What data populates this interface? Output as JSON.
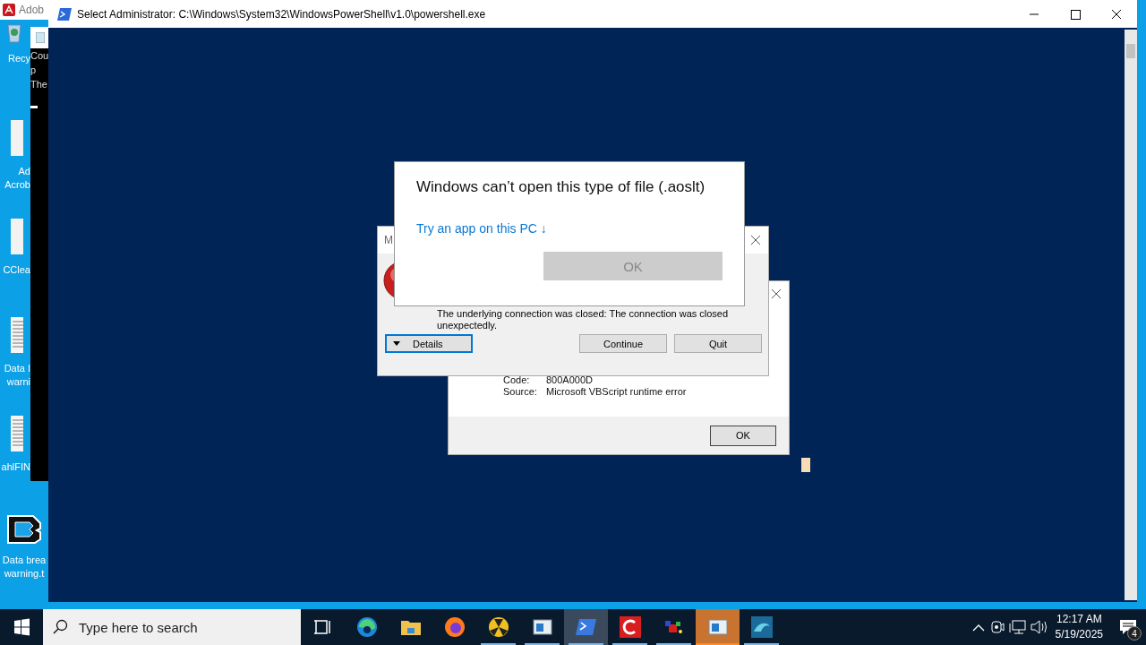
{
  "background_windows": {
    "adobe_title": "Adob",
    "console_lines": [
      "Cou",
      "p",
      "The"
    ]
  },
  "desktop_icons": [
    {
      "kind": "recycle",
      "lines": [
        "Recy"
      ]
    },
    {
      "kind": "document",
      "lines": [
        "Ad",
        "Acrob"
      ]
    },
    {
      "kind": "document",
      "lines": [
        "CClea"
      ]
    },
    {
      "kind": "textfile",
      "lines": [
        "Data I",
        "warni"
      ]
    },
    {
      "kind": "textfile",
      "lines": [
        "ahlFIN"
      ]
    },
    {
      "kind": "logo",
      "lines": [
        "Data brea",
        "warning.t"
      ]
    }
  ],
  "powershell": {
    "title": "Select Administrator: C:\\Windows\\System32\\WindowsPowerShell\\v1.0\\powershell.exe"
  },
  "script_error_dialog": {
    "details": [
      {
        "label": "Code:",
        "value": "800A000D"
      },
      {
        "label": "Source:",
        "value": "Microsoft VBScript runtime error"
      }
    ],
    "button": "OK"
  },
  "error_dialog": {
    "title": "M",
    "message": "The underlying connection was closed: The connection was closed unexpectedly.",
    "buttons": [
      {
        "kind": "details",
        "label": "Details",
        "focused": true
      },
      {
        "kind": "plain",
        "label": "Continue",
        "focused": false
      },
      {
        "kind": "plain",
        "label": "Quit",
        "focused": false
      }
    ]
  },
  "open_with_dialog": {
    "title": "Windows can’t open this type of file (.aoslt)",
    "link": "Try an app on this PC ↓",
    "button": {
      "label": "OK",
      "disabled": true
    }
  },
  "taskbar": {
    "search_placeholder": "Type here to search",
    "apps": [
      {
        "kind": "taskview",
        "running": false,
        "selected": false,
        "flashing": false
      },
      {
        "kind": "edge",
        "running": false,
        "selected": false,
        "flashing": false
      },
      {
        "kind": "folder",
        "running": false,
        "selected": false,
        "flashing": false
      },
      {
        "kind": "firefox",
        "running": false,
        "selected": false,
        "flashing": false
      },
      {
        "kind": "hazard",
        "running": true,
        "selected": false,
        "flashing": false
      },
      {
        "kind": "window",
        "running": true,
        "selected": false,
        "flashing": false
      },
      {
        "kind": "powershell",
        "running": true,
        "selected": true,
        "flashing": false
      },
      {
        "kind": "redc",
        "running": true,
        "selected": false,
        "flashing": false
      },
      {
        "kind": "blocks",
        "running": true,
        "selected": false,
        "flashing": false
      },
      {
        "kind": "window",
        "running": true,
        "selected": false,
        "flashing": true
      },
      {
        "kind": "dolphin",
        "running": true,
        "selected": false,
        "flashing": false
      }
    ],
    "time": "12:17 AM",
    "date": "5/19/2025",
    "notifications": "4"
  }
}
